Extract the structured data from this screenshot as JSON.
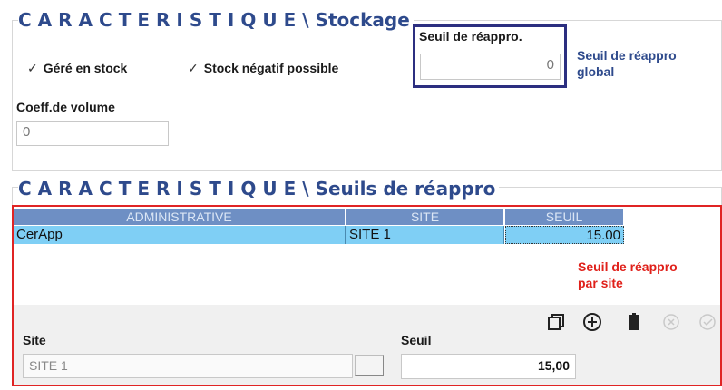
{
  "stockage": {
    "title_spaced": "CARACTERISTIQUE",
    "title_rest": "\\ Stockage",
    "gere_en_stock": "Géré en stock",
    "stock_negatif": "Stock négatif possible",
    "check_mark": "✓",
    "coeff_label": "Coeff.de volume",
    "coeff_value": "0",
    "seuil_label": "Seuil de réappro.",
    "seuil_value": "0",
    "global_note_line1": "Seuil de réappro",
    "global_note_line2": "global"
  },
  "seuils": {
    "title_spaced": "CARACTERISTIQUE",
    "title_rest": "\\ Seuils de réappro",
    "columns": [
      "ADMINISTRATIVE",
      "SITE",
      "SEUIL"
    ],
    "rows": [
      {
        "administrative": "CerApp",
        "site": "SITE 1",
        "seuil": "15.00"
      }
    ],
    "site_note_line1": "Seuil de réappro",
    "site_note_line2": "par site",
    "site_label": "Site",
    "site_value": "SITE 1",
    "seuil_label": "Seuil",
    "seuil_value": "15,00",
    "icons": [
      "copy-icon",
      "add-icon",
      "delete-icon",
      "cancel-icon",
      "validate-icon"
    ]
  },
  "colors": {
    "title": "#2e4a8c",
    "global_box_border": "#2c2f80",
    "site_box_border": "#e02424",
    "grid_header": "#6e8fc4",
    "grid_row_selected": "#7fcff5"
  }
}
